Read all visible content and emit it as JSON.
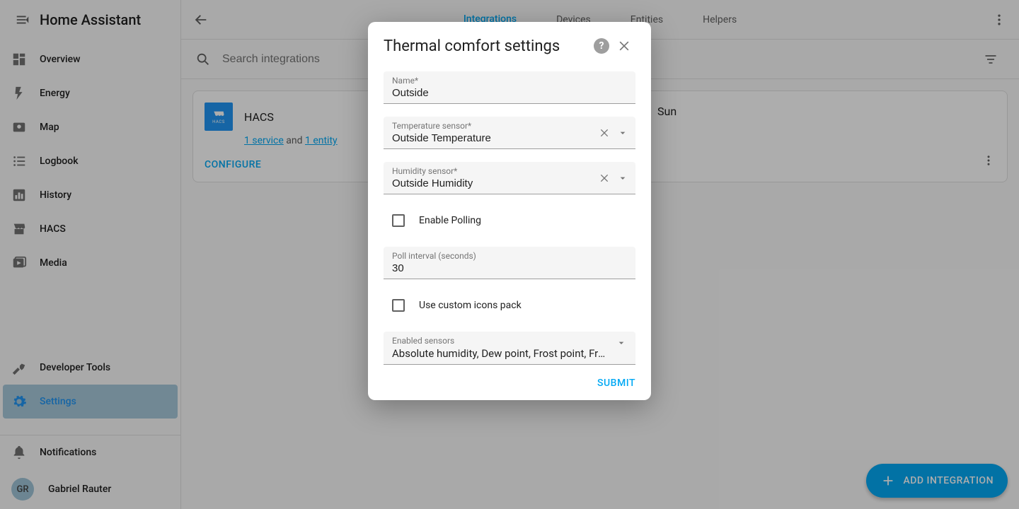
{
  "brand": "Home Assistant",
  "sidebar": {
    "items": [
      {
        "label": "Overview"
      },
      {
        "label": "Energy"
      },
      {
        "label": "Map"
      },
      {
        "label": "Logbook"
      },
      {
        "label": "History"
      },
      {
        "label": "HACS"
      },
      {
        "label": "Media"
      }
    ],
    "dev_tools": "Developer Tools",
    "settings": "Settings",
    "notifications": "Notifications"
  },
  "user": {
    "initials": "GR",
    "name": "Gabriel Rauter"
  },
  "tabs": {
    "integrations": "Integrations",
    "devices": "Devices",
    "entities": "Entities",
    "helpers": "Helpers"
  },
  "search": {
    "placeholder": "Search integrations"
  },
  "card": {
    "title": "HACS",
    "service_link": "1 service",
    "and": " and ",
    "entity_link": "1 entity",
    "configure": "CONFIGURE",
    "sun": "Sun"
  },
  "fab": {
    "label": "ADD INTEGRATION"
  },
  "dialog": {
    "title": "Thermal comfort settings",
    "name": {
      "label": "Name*",
      "value": "Outside"
    },
    "temp": {
      "label": "Temperature sensor*",
      "value": "Outside Temperature"
    },
    "hum": {
      "label": "Humidity sensor*",
      "value": "Outside Humidity"
    },
    "polling": {
      "label": "Enable Polling"
    },
    "interval": {
      "label": "Poll interval (seconds)",
      "value": "30"
    },
    "icons": {
      "label": "Use custom icons pack"
    },
    "enabled": {
      "label": "Enabled sensors",
      "value": "Absolute humidity, Dew point, Frost point, Frost ri…"
    },
    "submit": "SUBMIT"
  }
}
